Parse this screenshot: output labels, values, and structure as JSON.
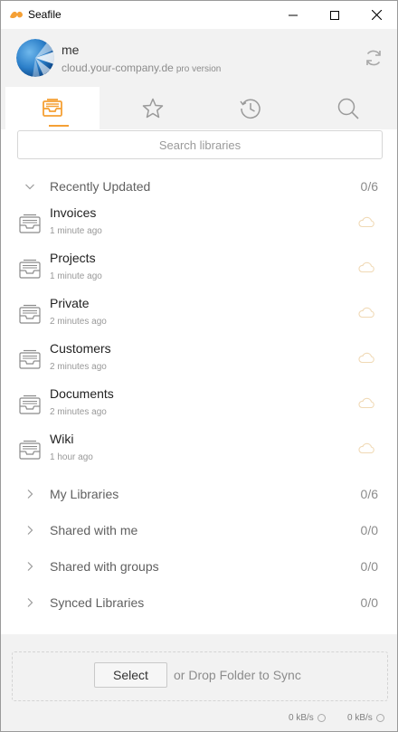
{
  "window": {
    "title": "Seafile",
    "minimize_icon": "minimize-icon",
    "maximize_icon": "maximize-icon",
    "close_icon": "close-icon"
  },
  "account": {
    "name": "me",
    "server": "cloud.your-company.de",
    "edition": "pro version",
    "refresh_icon": "refresh-icon"
  },
  "tabs": [
    {
      "name": "libraries",
      "icon": "library-icon",
      "active": true
    },
    {
      "name": "starred",
      "icon": "star-icon",
      "active": false
    },
    {
      "name": "activity",
      "icon": "history-icon",
      "active": false
    },
    {
      "name": "search",
      "icon": "search-icon",
      "active": false
    }
  ],
  "search": {
    "placeholder": "Search libraries"
  },
  "recently_updated": {
    "title": "Recently Updated",
    "count": "0/6",
    "expanded": true,
    "items": [
      {
        "name": "Invoices",
        "time": "1 minute ago"
      },
      {
        "name": "Projects",
        "time": "1 minute ago"
      },
      {
        "name": "Private",
        "time": "2 minutes ago"
      },
      {
        "name": "Customers",
        "time": "2 minutes ago"
      },
      {
        "name": "Documents",
        "time": "2 minutes ago"
      },
      {
        "name": "Wiki",
        "time": "1 hour ago"
      }
    ]
  },
  "groups": [
    {
      "title": "My Libraries",
      "count": "0/6"
    },
    {
      "title": "Shared with me",
      "count": "0/0"
    },
    {
      "title": "Shared with groups",
      "count": "0/0"
    },
    {
      "title": "Synced Libraries",
      "count": "0/0"
    }
  ],
  "dropzone": {
    "select_label": "Select",
    "text": "or Drop Folder to Sync"
  },
  "status": {
    "upload": "0 kB/s",
    "download": "0 kB/s"
  },
  "colors": {
    "accent": "#f5a035",
    "panel_bg": "#f2f2f2",
    "cloud_icon": "#f0d9b5"
  }
}
